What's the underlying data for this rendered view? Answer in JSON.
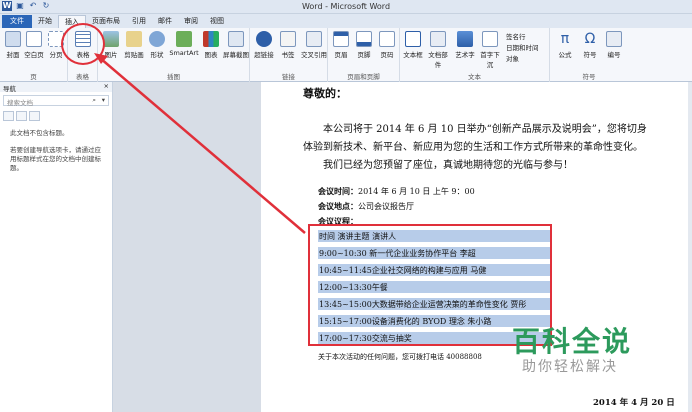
{
  "window": {
    "title": "Word - Microsoft Word"
  },
  "tabs": [
    "文件",
    "开始",
    "插入",
    "页面布局",
    "引用",
    "邮件",
    "审阅",
    "视图"
  ],
  "ribbon": {
    "pages": {
      "items": [
        "封面",
        "空白页",
        "分页"
      ],
      "name": "页"
    },
    "tables": {
      "items": [
        "表格"
      ],
      "name": "表格"
    },
    "illustrations": {
      "items": [
        "图片",
        "剪贴画",
        "形状",
        "SmartArt",
        "图表",
        "屏幕截图"
      ],
      "name": "插图"
    },
    "links": {
      "items": [
        "超链接",
        "书签",
        "交叉引用"
      ],
      "name": "链接"
    },
    "header_footer": {
      "items": [
        "页眉",
        "页脚",
        "页码"
      ],
      "name": "页眉和页脚"
    },
    "text": {
      "items": [
        "文本框",
        "文档部件",
        "艺术字",
        "首字下沉"
      ],
      "small": [
        "签名行",
        "日期和时间",
        "对象"
      ],
      "name": "文本"
    },
    "symbols": {
      "items": [
        "公式",
        "符号",
        "编号"
      ],
      "name": "符号"
    }
  },
  "nav": {
    "title": "导航",
    "search_placeholder": "搜索文档",
    "msg1": "此文档不包含标题。",
    "msg2": "若要创建导航选项卡，请通过应用标题样式在您的文档中创建标题。"
  },
  "doc": {
    "greeting": "尊敬的：",
    "para1a": "本公司将于 2014 年 6 月 10 日举办“创新产品展示及说明会”，您将切身",
    "para1b": "体验到新技术、新平台、新应用为您的生活和工作方式所带来的革命性变化。",
    "para2": "我们已经为您预留了座位，真诚地期待您的光临与参与！",
    "time_label": "会议时间：",
    "time_value": "2014 年 6 月 10 日 上午 9：00",
    "place_label": "会议地点：",
    "place_value": "公司会议报告厅",
    "agenda_label": "会议议程：",
    "agenda": [
      "时间      演讲主题       演讲人",
      "9:00~10:30  新一代企业业务协作平台   李超",
      "10:45~11:45企业社交网络的构建与应用      马健",
      "12:00~13:30午餐",
      "13:45~15:00大数据带给企业运营决策的革命性变化    贾彤",
      "15:15~17:00设备消费化的 BYOD 理念  朱小路",
      "17:00~17:30交流与抽奖"
    ],
    "footer_note": "关于本次活动的任何问题，您可拨打电话 40088808",
    "date": "2014 年 4 月 20 日"
  },
  "watermark": {
    "main": "百科全说",
    "sub": "助你轻松解决"
  },
  "colors": {
    "annotation": "#e0303a",
    "selection": "#b7cce9",
    "file_tab": "#2b66b8",
    "watermark": "#2c9a5c"
  }
}
